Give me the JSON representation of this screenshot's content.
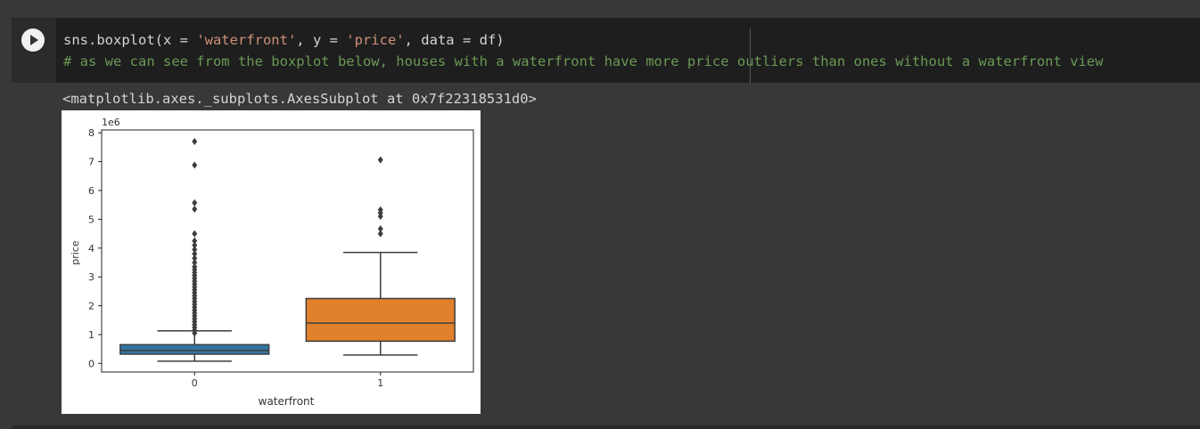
{
  "cell": {
    "run_icon": "play-circle-icon",
    "code_line1": {
      "a": "sns.boxplot(x = ",
      "b": "'waterfront'",
      "c": ", y = ",
      "d": "'price'",
      "e": ", data = df)"
    },
    "code_line2": "# as we can see from the boxplot below, houses with a waterfront have more price outliers than ones without a waterfront view",
    "output_text": "<matplotlib.axes._subplots.AxesSubplot at 0x7f22318531d0>"
  },
  "colors": {
    "string": "#ce9178",
    "comment": "#6a9955",
    "box_0": "#3274a1",
    "box_1": "#e1812c"
  },
  "chart_data": {
    "type": "box",
    "xlabel": "waterfront",
    "ylabel": "price",
    "offset_label": "1e6",
    "categories": [
      "0",
      "1"
    ],
    "ylim": [
      -0.3,
      8.1
    ],
    "yticks": [
      "0",
      "1",
      "2",
      "3",
      "4",
      "5",
      "6",
      "7",
      "8"
    ],
    "boxes": [
      {
        "category": "0",
        "whisker_low": 0.08,
        "q1": 0.32,
        "median": 0.45,
        "q3": 0.65,
        "whisker_high": 1.13,
        "outliers": [
          1.05,
          1.15,
          1.25,
          1.35,
          1.45,
          1.55,
          1.65,
          1.75,
          1.85,
          1.95,
          2.05,
          2.15,
          2.25,
          2.35,
          2.45,
          2.55,
          2.65,
          2.75,
          2.85,
          2.95,
          3.05,
          3.15,
          3.25,
          3.35,
          3.5,
          3.65,
          3.8,
          3.95,
          4.1,
          4.25,
          4.5,
          5.35,
          5.57,
          6.88,
          7.7
        ]
      },
      {
        "category": "1",
        "whisker_low": 0.29,
        "q1": 0.77,
        "median": 1.4,
        "q3": 2.25,
        "whisker_high": 3.85,
        "outliers": [
          4.5,
          4.67,
          5.1,
          5.22,
          5.33,
          7.06
        ]
      }
    ]
  }
}
